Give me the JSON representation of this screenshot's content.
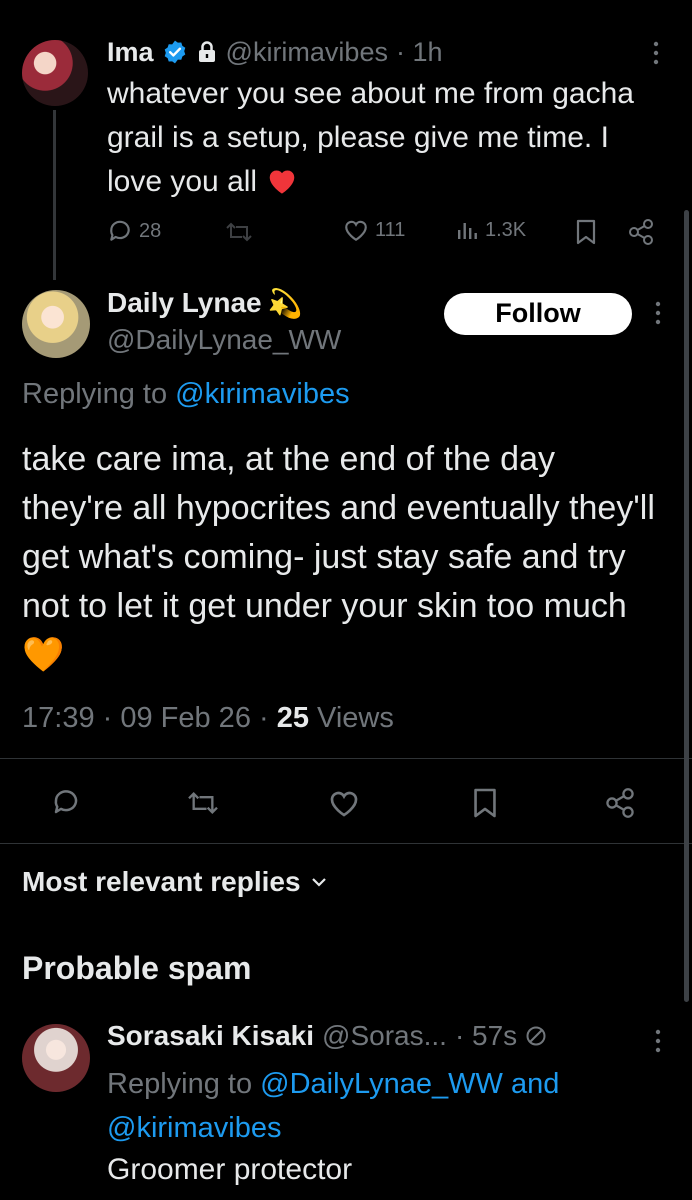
{
  "tweet1": {
    "name": "Ima",
    "handle": "@kirimavibes",
    "time": "· 1h",
    "text": "whatever you see about me from gacha grail is a setup, please give me time. I love you all",
    "replies": "28",
    "likes": "111",
    "views": "1.3K"
  },
  "main": {
    "name": "Daily Lynae",
    "emoji": "💫",
    "handle": "@DailyLynae_WW",
    "follow_label": "Follow",
    "replying_prefix": "Replying to",
    "replying_to": "@kirimavibes",
    "text": "take care ima, at the end of the day they're all hypocrites and eventually they'll get what's coming- just stay safe and try not to let it get under your skin too much",
    "emoji_end": "🧡",
    "timestamp": "17:39 · 09 Feb 26 ·",
    "views_count": "25",
    "views_label": "Views"
  },
  "sort": {
    "label": "Most relevant replies"
  },
  "section": {
    "title": "Probable spam"
  },
  "reply": {
    "name": "Sorasaki Kisaki",
    "handle": "@Soras...",
    "time": "· 57s",
    "replying_prefix": "Replying to",
    "replying_to": "@DailyLynae_WW",
    "replying_and": "and",
    "replying_to2": "@kirimavibes",
    "text": "Groomer protector"
  },
  "colors": {
    "accent": "#1d9bf0",
    "background": "#000000",
    "muted": "#71767b",
    "heart_red": "#f0353a",
    "heart_orange": "#ff9d1f"
  }
}
